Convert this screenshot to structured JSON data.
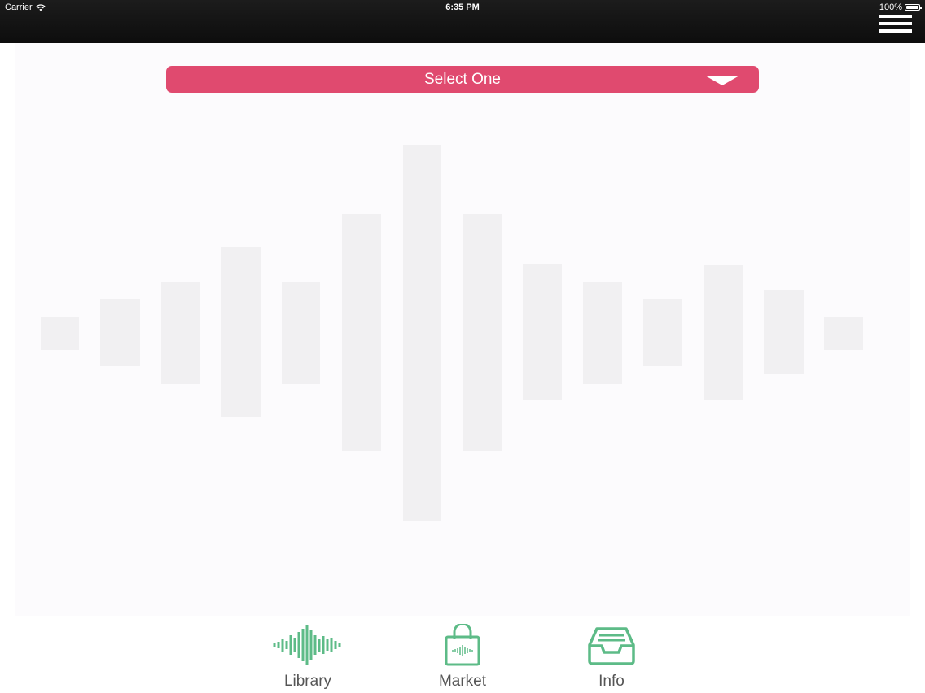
{
  "status_bar": {
    "carrier": "Carrier",
    "time": "6:35 PM",
    "battery": "100%"
  },
  "header": {
    "menu_icon": "hamburger-menu-icon"
  },
  "dropdown": {
    "label": "Select One",
    "icon": "dropdown-arrow-icon",
    "color": "#e04a6f"
  },
  "waveform": {
    "icon": "waveform-placeholder",
    "bar_color": "#f1f0f2"
  },
  "tabs": [
    {
      "label": "Library",
      "icon": "waveform-icon"
    },
    {
      "label": "Market",
      "icon": "shopping-bag-icon"
    },
    {
      "label": "Info",
      "icon": "inbox-tray-icon"
    }
  ],
  "colors": {
    "accent": "#e04a6f",
    "tab_icon": "#5dbb87",
    "topbar": "#111111"
  }
}
